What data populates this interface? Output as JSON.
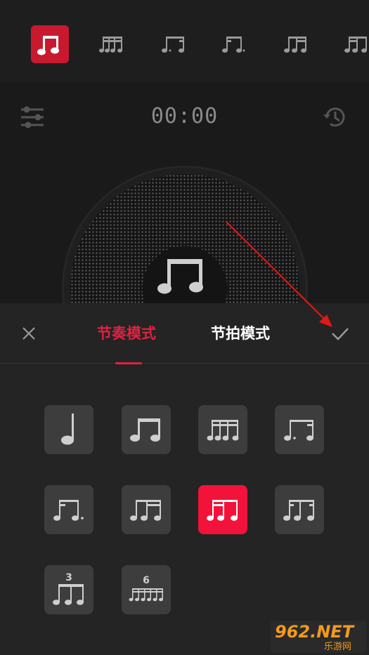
{
  "strip": {
    "items": [
      {
        "icon": "eighth-pair-icon",
        "active": true
      },
      {
        "icon": "sixteenth-quad-icon",
        "active": false
      },
      {
        "icon": "dotted-eighth-sixteenth-icon",
        "active": false
      },
      {
        "icon": "sixteenth-dotted-eighth-icon",
        "active": false
      },
      {
        "icon": "eighth-two-sixteenths-icon",
        "active": false
      },
      {
        "icon": "two-sixteenths-eighth-icon",
        "active": false
      }
    ]
  },
  "player": {
    "timer": "00:00"
  },
  "sheet": {
    "tabs": [
      {
        "label": "节奏模式",
        "active": true
      },
      {
        "label": "节拍模式",
        "active": false
      }
    ],
    "tiles": [
      {
        "icon": "quarter-note-icon",
        "selected": false
      },
      {
        "icon": "eighth-pair-icon",
        "selected": false
      },
      {
        "icon": "sixteenth-quad-icon",
        "selected": false
      },
      {
        "icon": "dotted-eighth-sixteenth-icon",
        "selected": false
      },
      {
        "icon": "sixteenth-dotted-eighth-icon",
        "selected": false
      },
      {
        "icon": "eighth-two-sixteenths-icon",
        "selected": false
      },
      {
        "icon": "two-sixteenths-eighth-icon",
        "selected": true
      },
      {
        "icon": "sixteenth-eighth-sixteenth-icon",
        "selected": false
      },
      {
        "icon": "triplet-icon",
        "selected": false,
        "label": "3"
      },
      {
        "icon": "sextuplet-icon",
        "selected": false,
        "label": "6"
      }
    ]
  },
  "watermark": {
    "main": "962.NET",
    "sub": "乐游网"
  },
  "colors": {
    "accent": "#e0213f",
    "selected_tile": "#f2123a",
    "tile": "#3d3d3d",
    "background": "#1a1a1a"
  }
}
